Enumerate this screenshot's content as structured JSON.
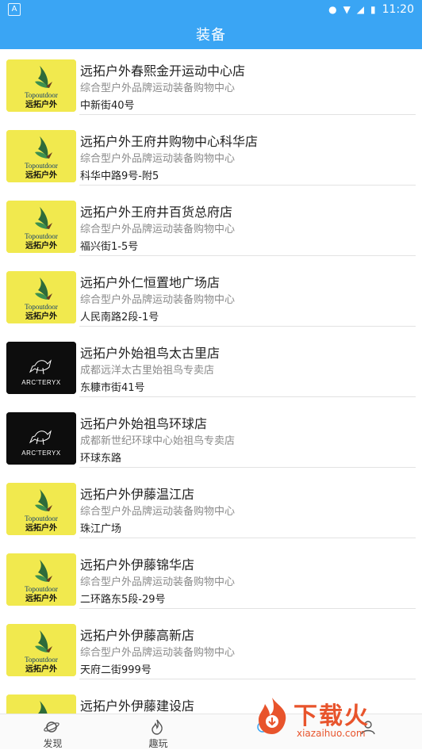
{
  "status_bar": {
    "time": "11:20"
  },
  "header": {
    "title": "装备"
  },
  "colors": {
    "accent": "#3aa5f4",
    "logo_yellow": "#f1e94e",
    "arcteryx_black": "#0d0d0d"
  },
  "stores": [
    {
      "name": "远拓户外春熙金开运动中心店",
      "desc": "综合型户外品牌运动装备购物中心",
      "address": "中新街40号",
      "logo": "topoutdoor"
    },
    {
      "name": "远拓户外王府井购物中心科华店",
      "desc": "综合型户外品牌运动装备购物中心",
      "address": "科华中路9号-附5",
      "logo": "topoutdoor"
    },
    {
      "name": "远拓户外王府井百货总府店",
      "desc": "综合型户外品牌运动装备购物中心",
      "address": "福兴街1-5号",
      "logo": "topoutdoor"
    },
    {
      "name": "远拓户外仁恒置地广场店",
      "desc": "综合型户外品牌运动装备购物中心",
      "address": "人民南路2段-1号",
      "logo": "topoutdoor"
    },
    {
      "name": "远拓户外始祖鸟太古里店",
      "desc": "成都远洋太古里始祖鸟专卖店",
      "address": "东糠市街41号",
      "logo": "arcteryx"
    },
    {
      "name": "远拓户外始祖鸟环球店",
      "desc": "成都新世纪环球中心始祖鸟专卖店",
      "address": "环球东路",
      "logo": "arcteryx"
    },
    {
      "name": "远拓户外伊藤温江店",
      "desc": "综合型户外品牌运动装备购物中心",
      "address": "珠江广场",
      "logo": "topoutdoor"
    },
    {
      "name": "远拓户外伊藤锦华店",
      "desc": "综合型户外品牌运动装备购物中心",
      "address": "二环路东5段-29号",
      "logo": "topoutdoor"
    },
    {
      "name": "远拓户外伊藤高新店",
      "desc": "综合型户外品牌运动装备购物中心",
      "address": "天府二街999号",
      "logo": "topoutdoor"
    },
    {
      "name": "远拓户外伊藤建设店",
      "desc": "",
      "address": "",
      "logo": "topoutdoor"
    }
  ],
  "logo_text": {
    "topoutdoor_en": "Topoutdoor",
    "topoutdoor_cn": "远拓户外",
    "arcteryx": "ARC'TERYX"
  },
  "bottom_nav": [
    {
      "label": "发现",
      "icon": "planet-icon",
      "active": false
    },
    {
      "label": "趣玩",
      "icon": "flame-icon",
      "active": false
    },
    {
      "label": "",
      "icon": "gear-icon",
      "active": true
    },
    {
      "label": "",
      "icon": "person-icon",
      "active": false
    }
  ],
  "watermark": {
    "text": "下载火",
    "url": "xiazaihuo.com"
  }
}
